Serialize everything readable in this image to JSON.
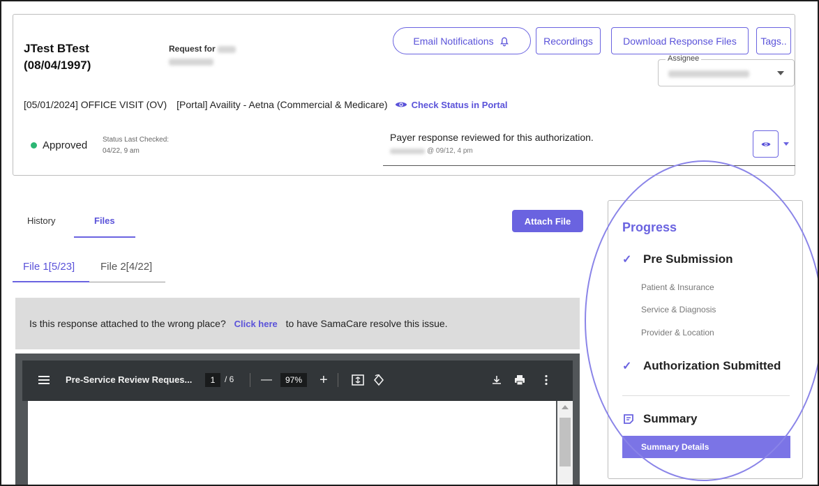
{
  "patient": {
    "name": "JTest BTest",
    "dob": "(08/04/1997)",
    "request_for_label": "Request for"
  },
  "header_buttons": {
    "email_notifications": "Email Notifications",
    "recordings": "Recordings",
    "download_response_files": "Download Response Files",
    "tags": "Tags.."
  },
  "assignee": {
    "label": "Assignee"
  },
  "visit": {
    "service": "[05/01/2024] OFFICE VISIT (OV)",
    "portal": "[Portal] Availity - Aetna (Commercial & Medicare)",
    "check_status_link": "Check Status in Portal"
  },
  "status": {
    "value": "Approved",
    "last_checked_label": "Status Last Checked:",
    "last_checked_value": "04/22, 9 am",
    "color": "#2bb673"
  },
  "payer_response": {
    "message": "Payer response reviewed for this authorization.",
    "meta": "@ 09/12, 4 pm"
  },
  "tabs": {
    "history": "History",
    "files": "Files"
  },
  "attach_file_label": "Attach File",
  "file_tabs": [
    "File 1[5/23]",
    "File 2[4/22]"
  ],
  "wrong_place": {
    "question": "Is this response attached to the wrong place?",
    "link": "Click here",
    "suffix": "to have SamaCare resolve this issue."
  },
  "pdf_viewer": {
    "title": "Pre-Service Review Reques...",
    "current_page": "1",
    "total_pages": "/  6",
    "zoom": "97%",
    "minus": "—",
    "plus": "+"
  },
  "progress": {
    "title": "Progress",
    "steps": [
      {
        "label": "Pre Submission",
        "substeps": [
          "Patient & Insurance",
          "Service & Diagnosis",
          "Provider & Location"
        ]
      },
      {
        "label": "Authorization Submitted"
      }
    ],
    "summary_label": "Summary",
    "summary_details": "Summary Details"
  },
  "colors": {
    "accent": "#6a63e0",
    "summary_bg": "#7b74e6",
    "pdf_toolbar": "#323639"
  }
}
